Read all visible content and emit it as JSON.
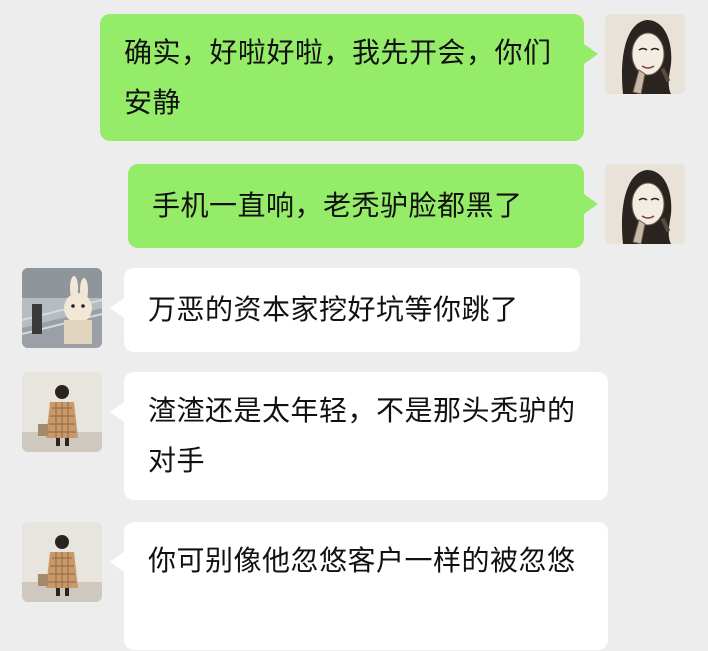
{
  "messages": [
    {
      "sender": "self",
      "avatar": "sketch-woman-avatar",
      "text": "确实，好啦好啦，我先开会，你们安静"
    },
    {
      "sender": "self",
      "avatar": "sketch-woman-avatar",
      "text": "手机一直响，老秃驴脸都黑了"
    },
    {
      "sender": "friend1",
      "avatar": "rabbit-costume-avatar",
      "text": "万恶的资本家挖好坑等你跳了"
    },
    {
      "sender": "friend2",
      "avatar": "plaid-coat-girl-avatar",
      "text": "渣渣还是太年轻，不是那头秃驴的对手"
    },
    {
      "sender": "friend2",
      "avatar": "plaid-coat-girl-avatar",
      "text": "你可别像他忽悠客户一样的被忽悠"
    }
  ],
  "colors": {
    "background": "#ededed",
    "outgoing_bubble": "#95ec69",
    "incoming_bubble": "#ffffff"
  }
}
